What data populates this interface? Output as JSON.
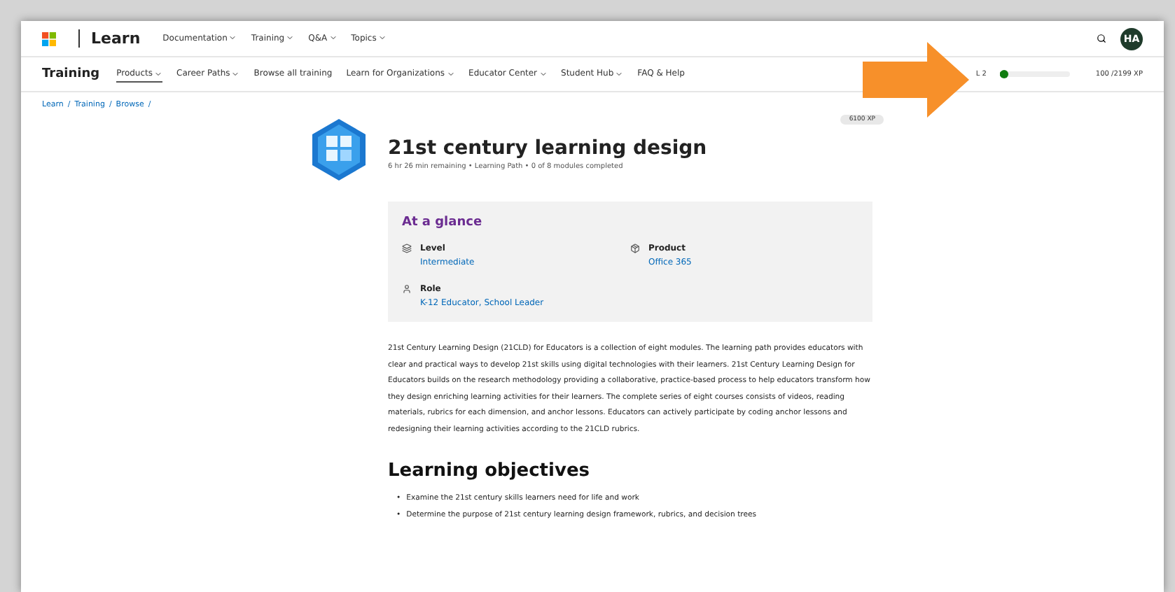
{
  "top_nav": {
    "brand": "Learn",
    "items": [
      {
        "label": "Documentation"
      },
      {
        "label": "Training"
      },
      {
        "label": "Q&A"
      },
      {
        "label": "Topics"
      }
    ],
    "avatar": "HA"
  },
  "sub_nav": {
    "title": "Training",
    "items": [
      {
        "label": "Products",
        "dropdown": true,
        "selected": true
      },
      {
        "label": "Career Paths",
        "dropdown": true,
        "selected": false
      },
      {
        "label": "Browse all training",
        "dropdown": false,
        "selected": false
      },
      {
        "label": "Learn for Organizations",
        "dropdown": true,
        "selected": false
      },
      {
        "label": "Educator Center",
        "dropdown": true,
        "selected": false
      },
      {
        "label": "Student Hub",
        "dropdown": true,
        "selected": false
      },
      {
        "label": "FAQ & Help",
        "dropdown": false,
        "selected": false
      }
    ],
    "level_label": "L 2",
    "level": 0.05,
    "xp": "100 /2199 XP"
  },
  "breadcrumb": [
    {
      "label": "Learn",
      "separator": "/"
    },
    {
      "label": "Training",
      "separator": "/"
    },
    {
      "label": "Browse",
      "separator": "/"
    }
  ],
  "header": {
    "xp_badge": "6100 XP",
    "title": "21st century learning design",
    "meta": "6 hr 26 min remaining • Learning Path • 0 of 8 modules completed"
  },
  "glance": {
    "title": "At a glance",
    "facts": [
      {
        "kind": "level",
        "label": "Level",
        "value": "Intermediate"
      },
      {
        "kind": "product",
        "label": "Product",
        "value": "Office 365"
      },
      {
        "kind": "role",
        "label": "Role",
        "value": "K-12 Educator, School Leader"
      }
    ]
  },
  "description": "21st Century Learning Design (21CLD) for Educators is a collection of eight modules. The learning path provides educators with clear and practical ways to develop 21st skills using digital technologies with their learners. 21st Century Learning Design for Educators builds on the research methodology providing a collaborative, practice-based process to help educators transform how they design enriching learning activities for their learners. The complete series of eight courses consists of videos, reading materials, rubrics for each dimension, and anchor lessons. Educators can actively participate by coding anchor lessons and redesigning their learning activities according to the 21CLD rubrics.",
  "objectives": {
    "title": "Learning objectives",
    "items": [
      {
        "marker": "•",
        "text": "Examine the 21st century skills learners need for life and work"
      },
      {
        "marker": "•",
        "text": "Determine the purpose of 21st century learning design framework, rubrics, and decision trees"
      }
    ]
  }
}
